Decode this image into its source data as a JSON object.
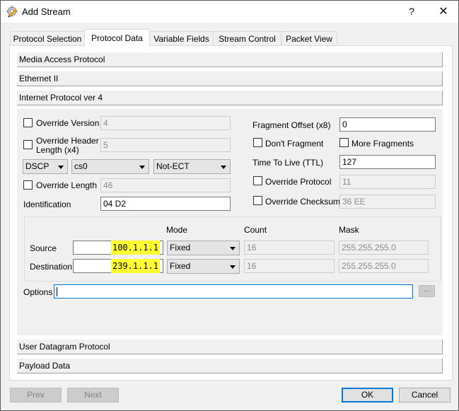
{
  "window": {
    "title": "Add Stream",
    "help_label": "?",
    "close_label": "✕",
    "icon": "gear-pencil-icon"
  },
  "tabs": [
    {
      "label": "Protocol Selection",
      "active": false
    },
    {
      "label": "Protocol Data",
      "active": true
    },
    {
      "label": "Variable Fields",
      "active": false
    },
    {
      "label": "Stream Control",
      "active": false
    },
    {
      "label": "Packet View",
      "active": false
    }
  ],
  "sections": {
    "mac": "Media Access Protocol",
    "eth": "Ethernet II",
    "ipv4": "Internet Protocol ver 4",
    "udp": "User Datagram Protocol",
    "payload": "Payload Data"
  },
  "ipv4": {
    "override_version": {
      "label": "Override Version",
      "checked": false,
      "value": "4"
    },
    "override_header_length": {
      "label_line1": "Override Header",
      "label_line2": "Length (x4)",
      "checked": false,
      "value": "5"
    },
    "dscp_select": "DSCP",
    "cs_select": "cs0",
    "ecn_select": "Not-ECT",
    "override_length": {
      "label": "Override Length",
      "checked": false,
      "value": "46"
    },
    "identification": {
      "label": "Identification",
      "value": "04 D2"
    },
    "fragment_offset": {
      "label": "Fragment Offset (x8)",
      "value": "0"
    },
    "dont_fragment": {
      "label": "Don't Fragment",
      "checked": false
    },
    "more_fragments": {
      "label": "More Fragments",
      "checked": false
    },
    "ttl": {
      "label": "Time To Live (TTL)",
      "value": "127"
    },
    "override_protocol": {
      "label": "Override Protocol",
      "checked": false,
      "value": "11"
    },
    "override_checksum": {
      "label": "Override Checksum",
      "checked": false,
      "value": "36 EE"
    },
    "address_headers": {
      "mode": "Mode",
      "count": "Count",
      "mask": "Mask"
    },
    "source": {
      "label": "Source",
      "value": "100.1.1.1",
      "mode": "Fixed",
      "count": "16",
      "mask": "255.255.255.0"
    },
    "destination": {
      "label": "Destination",
      "value": "239.1.1.1",
      "mode": "Fixed",
      "count": "16",
      "mask": "255.255.255.0"
    },
    "options": {
      "label": "Options",
      "value": "",
      "browse_label": "..."
    }
  },
  "buttons": {
    "prev": "Prev",
    "next": "Next",
    "ok": "OK",
    "cancel": "Cancel"
  },
  "colors": {
    "highlight": "#ffff33",
    "focus_border": "#0078d7"
  }
}
